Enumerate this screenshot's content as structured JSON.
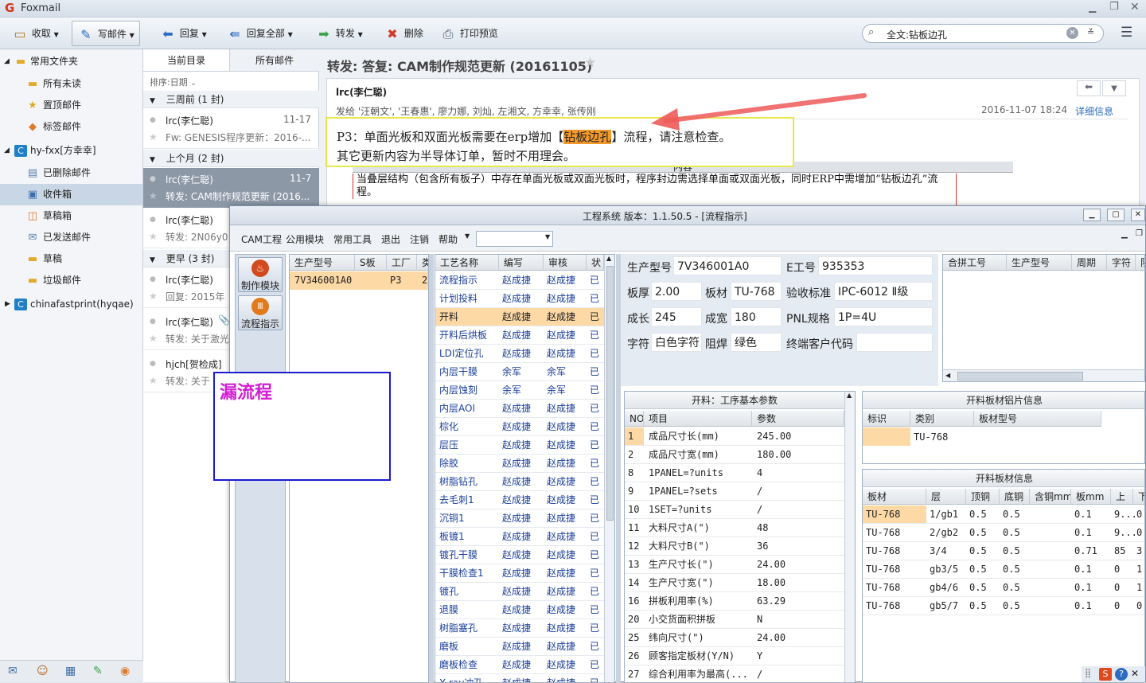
{
  "app": {
    "name": "Foxmail"
  },
  "toolbar": {
    "receive": "收取",
    "compose": "写邮件",
    "reply": "回复",
    "reply_all": "回复全部",
    "forward": "转发",
    "delete": "删除",
    "print_preview": "打印预览",
    "search_value": "全文:钻板边孔"
  },
  "sidebar": {
    "common_folder": "常用文件夹",
    "common_items": [
      "所有未读",
      "置顶邮件",
      "标签邮件"
    ],
    "account1": "hy-fxx[方幸幸]",
    "account1_items": [
      "已删除邮件",
      "收件箱",
      "草稿箱",
      "已发送邮件",
      "草稿",
      "垃圾邮件"
    ],
    "account2": "chinafastprint(hyqae)"
  },
  "maillist": {
    "tab_current": "当前目录",
    "tab_all": "所有邮件",
    "sort": "排序:日期",
    "group1": "三周前 (1 封)",
    "group2": "上个月 (2 封)",
    "group3": "更早 (3 封)",
    "mails": [
      {
        "from": "lrc(李仁聪)",
        "date": "11-17",
        "subject": "Fw: GENESIS程序更新：2016-..."
      },
      {
        "from": "lrc(李仁聪)",
        "date": "11-7",
        "subject": "转发: CAM制作规范更新 (2016..."
      },
      {
        "from": "lrc(李仁聪)",
        "date": "",
        "subject": "转发: 2N06y0"
      },
      {
        "from": "lrc(李仁聪)",
        "date": "",
        "subject": "回复: 2015年"
      },
      {
        "from": "lrc(李仁聪)",
        "date": "",
        "subject": "转发: 关于激光"
      },
      {
        "from": "hjch[贺检成]",
        "date": "",
        "subject": "转发: 关于"
      }
    ]
  },
  "reading": {
    "subject": "转发: 答复: CAM制作规范更新 (20161105)",
    "sender": "lrc(李仁聪)",
    "recipients": "发给 '汪朝文', '王春惠', 廖力娜, 刘灿, 左湘文, 方幸幸, 张传刚",
    "date": "2016-11-07 18:24",
    "details": "详细信息",
    "p3_before": "P3：单面光板和双面光板需要在erp增加【",
    "p3_highlight": "钻板边孔",
    "p3_after": "】流程，请注意检查。",
    "line2": "其它更新内容为半导体订单，暂时不用理会。",
    "table_header": "内容",
    "para": "当叠层结构（包含所有板子）中存在单面光板或双面光板时，程序封边需选择单面或双面光板，同时ERP中需增加“钻板边孔”流程。"
  },
  "annotation": {
    "text": "漏流程"
  },
  "appwin": {
    "title": "工程系统   版本：1.1.50.5 - [流程指示]",
    "menu": [
      "CAM工程",
      "公用模块",
      "常用工具",
      "退出",
      "注销",
      "帮助"
    ],
    "nav": [
      "制作模块",
      "流程指示"
    ],
    "prod_headers": [
      "生产型号",
      "S板",
      "工厂",
      "类"
    ],
    "prod_row": [
      "7V346001A0",
      "",
      "P3",
      "2"
    ],
    "proc_headers": [
      "工艺名称",
      "编写",
      "审核",
      "状"
    ],
    "processes": [
      [
        "流程指示",
        "赵成捷",
        "赵成捷",
        "已"
      ],
      [
        "计划投料",
        "赵成捷",
        "赵成捷",
        "已"
      ],
      [
        "开料",
        "赵成捷",
        "赵成捷",
        "已"
      ],
      [
        "开料后烘板",
        "赵成捷",
        "赵成捷",
        "已"
      ],
      [
        "LDI定位孔",
        "赵成捷",
        "赵成捷",
        "已"
      ],
      [
        "内层干膜",
        "余军",
        "余军",
        "已"
      ],
      [
        "内层蚀刻",
        "余军",
        "余军",
        "已"
      ],
      [
        "内层AOI",
        "赵成捷",
        "赵成捷",
        "已"
      ],
      [
        "棕化",
        "赵成捷",
        "赵成捷",
        "已"
      ],
      [
        "层压",
        "赵成捷",
        "赵成捷",
        "已"
      ],
      [
        "除胶",
        "赵成捷",
        "赵成捷",
        "已"
      ],
      [
        "树脂钻孔",
        "赵成捷",
        "赵成捷",
        "已"
      ],
      [
        "去毛刺1",
        "赵成捷",
        "赵成捷",
        "已"
      ],
      [
        "沉铜1",
        "赵成捷",
        "赵成捷",
        "已"
      ],
      [
        "板镀1",
        "赵成捷",
        "赵成捷",
        "已"
      ],
      [
        "镀孔干膜",
        "赵成捷",
        "赵成捷",
        "已"
      ],
      [
        "干膜检查1",
        "赵成捷",
        "赵成捷",
        "已"
      ],
      [
        "镀孔",
        "赵成捷",
        "赵成捷",
        "已"
      ],
      [
        "退膜",
        "赵成捷",
        "赵成捷",
        "已"
      ],
      [
        "树脂塞孔",
        "赵成捷",
        "赵成捷",
        "已"
      ],
      [
        "磨板",
        "赵成捷",
        "赵成捷",
        "已"
      ],
      [
        "磨板检查",
        "赵成捷",
        "赵成捷",
        "已"
      ],
      [
        "X-ray冲孔",
        "赵成捷",
        "赵成捷",
        "已"
      ]
    ],
    "info": {
      "prod_label": "生产型号",
      "prod": "7V346001A0",
      "eno_label": "E工号",
      "eno": "935353",
      "thick_label": "板厚",
      "thick": "2.00",
      "material_label": "板材",
      "material": "TU-768",
      "std_label": "验收标准",
      "std": "IPC-6012 Ⅱ级",
      "len_label": "成长",
      "len": "245",
      "wid_label": "成宽",
      "wid": "180",
      "pnl_label": "PNL规格",
      "pnl": "1P=4U",
      "char_label": "字符",
      "char": "白色字符",
      "mask_label": "阻焊",
      "mask": "绿色",
      "cust_label": "终端客户代码",
      "cust": ""
    },
    "combine_headers": [
      "合拼工号",
      "生产型号",
      "周期",
      "字符",
      "阻"
    ],
    "params_title": "开料：工序基本参数",
    "params_headers": [
      "NO",
      "项目",
      "参数"
    ],
    "params": [
      [
        "1",
        "成品尺寸长(mm)",
        "245.00"
      ],
      [
        "2",
        "成品尺寸宽(mm)",
        "180.00"
      ],
      [
        "8",
        "1PANEL=?units",
        "4"
      ],
      [
        "9",
        "1PANEL=?sets",
        "/"
      ],
      [
        "10",
        "1SET=?units",
        "/"
      ],
      [
        "11",
        "大料尺寸A(\")",
        "48"
      ],
      [
        "12",
        "大料尺寸B(\")",
        "36"
      ],
      [
        "13",
        "生产尺寸长(\")",
        "24.00"
      ],
      [
        "14",
        "生产尺寸宽(\")",
        "18.00"
      ],
      [
        "16",
        "拼板利用率(%)",
        "63.29"
      ],
      [
        "20",
        "小交货面积拼板",
        "N"
      ],
      [
        "25",
        "纬向尺寸(\")",
        "24.00"
      ],
      [
        "26",
        "顾客指定板材(Y/N)",
        "Y"
      ],
      [
        "27",
        "综合利用率为最高(...",
        "/"
      ]
    ],
    "foil_title": "开料板材铝片信息",
    "foil_headers": [
      "标识",
      "类别",
      "板材型号"
    ],
    "foil_row": [
      "",
      "TU-768",
      ""
    ],
    "board_title": "开料板材信息",
    "board_headers": [
      "板材",
      "层",
      "顶铜",
      "底铜",
      "含铜mm",
      "板mm",
      "上",
      "下"
    ],
    "boards": [
      [
        "TU-768",
        "1/gb1",
        "0.5",
        "0.5",
        "",
        "0.1",
        "9...",
        "0"
      ],
      [
        "TU-768",
        "2/gb2",
        "0.5",
        "0.5",
        "",
        "0.1",
        "9...",
        "0"
      ],
      [
        "TU-768",
        "3/4",
        "0.5",
        "0.5",
        "",
        "0.71",
        "85",
        "3"
      ],
      [
        "TU-768",
        "gb3/5",
        "0.5",
        "0.5",
        "",
        "0.1",
        "0",
        "1"
      ],
      [
        "TU-768",
        "gb4/6",
        "0.5",
        "0.5",
        "",
        "0.1",
        "0",
        "1"
      ],
      [
        "TU-768",
        "gb5/7",
        "0.5",
        "0.5",
        "",
        "0.1",
        "0",
        "0"
      ]
    ]
  }
}
